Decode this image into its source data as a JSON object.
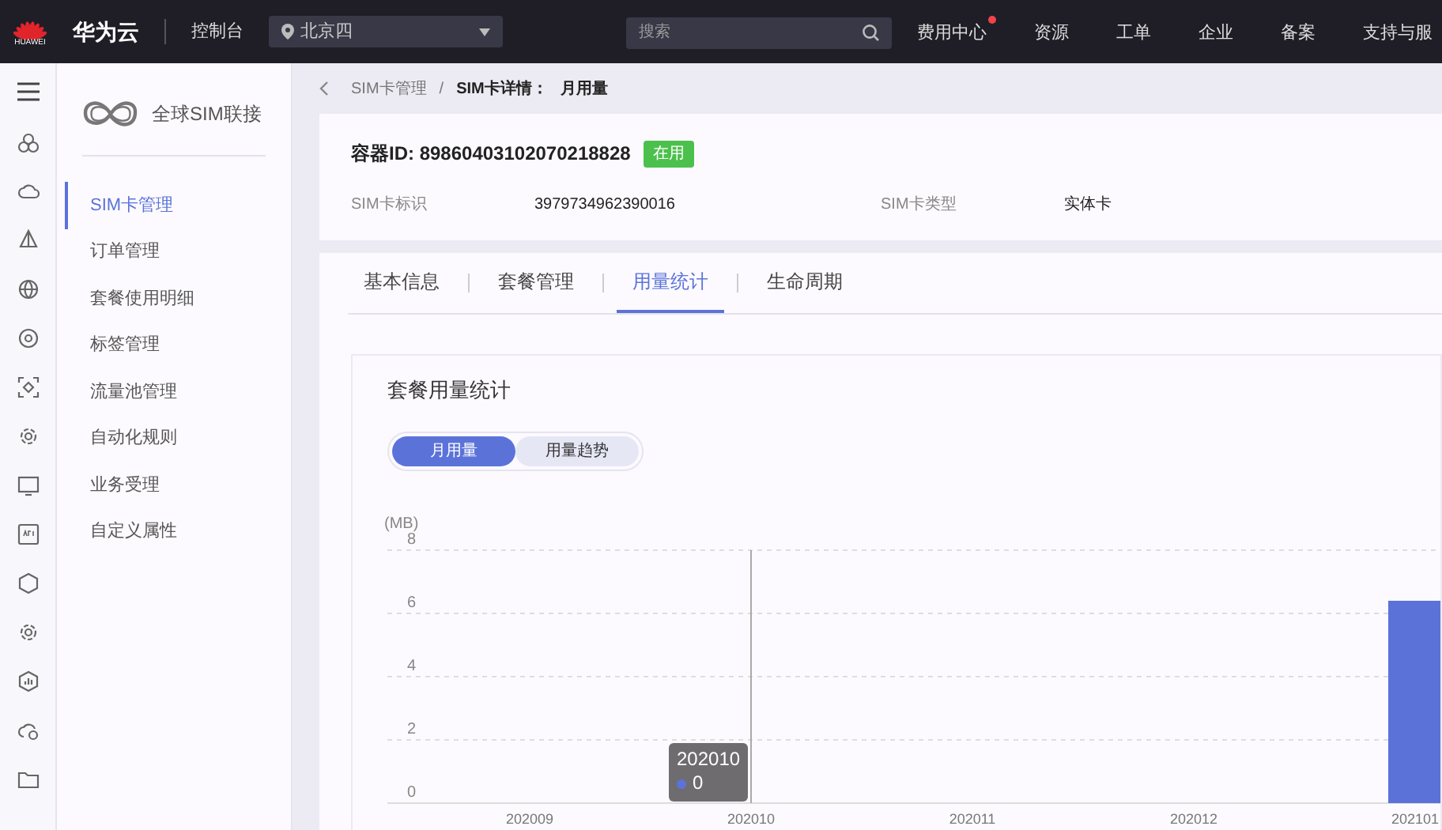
{
  "topbar": {
    "logo_text": "HUAWEI",
    "brand": "华为云",
    "console": "控制台",
    "region": "北京四",
    "search": {
      "placeholder": "搜索"
    },
    "nav": [
      {
        "label": "费用中心",
        "notify": true
      },
      {
        "label": "资源",
        "notify": false
      },
      {
        "label": "工单",
        "notify": false
      },
      {
        "label": "企业",
        "notify": false
      },
      {
        "label": "备案",
        "notify": false
      },
      {
        "label": "支持与服",
        "notify": false
      }
    ]
  },
  "sidebar": {
    "title": "全球SIM联接",
    "items": [
      {
        "label": "SIM卡管理",
        "selected": true
      },
      {
        "label": "订单管理",
        "selected": false
      },
      {
        "label": "套餐使用明细",
        "selected": false
      },
      {
        "label": "标签管理",
        "selected": false
      },
      {
        "label": "流量池管理",
        "selected": false
      },
      {
        "label": "自动化规则",
        "selected": false
      },
      {
        "label": "业务受理",
        "selected": false
      },
      {
        "label": "自定义属性",
        "selected": false
      }
    ]
  },
  "breadcrumb": {
    "items": [
      "SIM卡管理",
      "SIM卡详情：",
      "月用量"
    ],
    "separator": "/"
  },
  "header": {
    "title": "容器ID: 89860403102070218828",
    "status": "在用",
    "fields": [
      {
        "label": "SIM卡标识",
        "value": "3979734962390016"
      },
      {
        "label": "SIM卡类型",
        "value": "实体卡"
      }
    ]
  },
  "tabs": [
    {
      "label": "基本信息",
      "selected": false
    },
    {
      "label": "套餐管理",
      "selected": false
    },
    {
      "label": "用量统计",
      "selected": true
    },
    {
      "label": "生命周期",
      "selected": false
    }
  ],
  "usage": {
    "title": "套餐用量统计",
    "toggle": [
      {
        "label": "月用量",
        "selected": true
      },
      {
        "label": "用量趋势",
        "selected": false
      }
    ],
    "chart_data": {
      "type": "bar",
      "ylabel": "(MB)",
      "categories": [
        "202009",
        "202010",
        "202011",
        "202012",
        "202101"
      ],
      "series": [
        {
          "color": "#5b73d9",
          "values": [
            0,
            0,
            0,
            0,
            6.4
          ]
        }
      ],
      "ylim": [
        0,
        8
      ],
      "yticks": [
        0,
        2,
        4,
        6,
        8
      ],
      "grid": true,
      "ref_lines": [
        {
          "axis": "x",
          "value": "202010",
          "color": "#aaaaaa"
        }
      ]
    },
    "tooltip": {
      "title": "202010",
      "value": "0",
      "color": "#5b73d9"
    }
  }
}
